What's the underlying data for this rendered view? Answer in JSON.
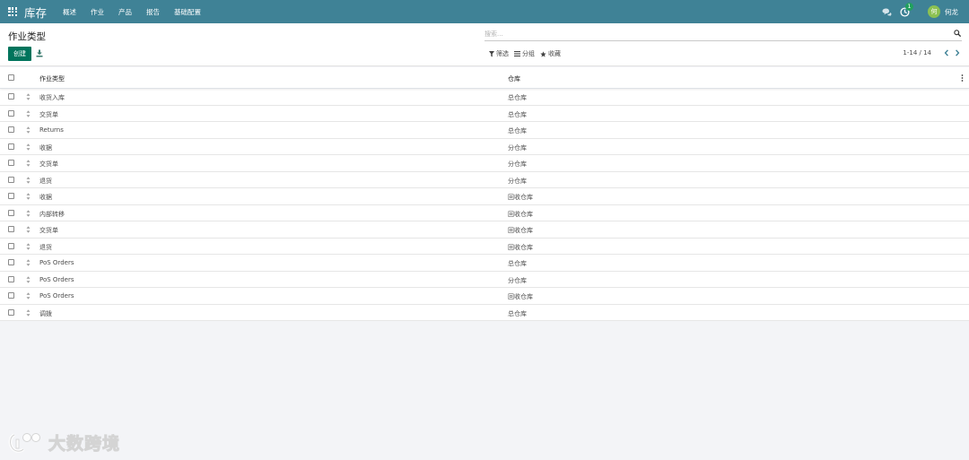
{
  "navbar": {
    "brand": "库存",
    "menu": [
      "概述",
      "作业",
      "产品",
      "报告",
      "基础配置"
    ],
    "activity_count": "1",
    "user_initial": "何",
    "user_name": "何龙",
    "bg_color": "#3f8296"
  },
  "control_panel": {
    "title": "作业类型",
    "search_placeholder": "搜索...",
    "create_label": "创建",
    "filters": {
      "filter": "筛选",
      "group_by": "分组",
      "favorites": "收藏"
    },
    "pager": "1-14 / 14"
  },
  "table": {
    "columns": {
      "name": "作业类型",
      "warehouse": "仓库"
    },
    "rows": [
      {
        "name": "收货入库",
        "warehouse": "总仓库"
      },
      {
        "name": "交货单",
        "warehouse": "总仓库"
      },
      {
        "name": "Returns",
        "warehouse": "总仓库"
      },
      {
        "name": "收据",
        "warehouse": "分仓库"
      },
      {
        "name": "交货单",
        "warehouse": "分仓库"
      },
      {
        "name": "退货",
        "warehouse": "分仓库"
      },
      {
        "name": "收据",
        "warehouse": "回收仓库"
      },
      {
        "name": "内部转移",
        "warehouse": "回收仓库"
      },
      {
        "name": "交货单",
        "warehouse": "回收仓库"
      },
      {
        "name": "退货",
        "warehouse": "回收仓库"
      },
      {
        "name": "PoS Orders",
        "warehouse": "总仓库"
      },
      {
        "name": "PoS Orders",
        "warehouse": "分仓库"
      },
      {
        "name": "PoS Orders",
        "warehouse": "回收仓库"
      },
      {
        "name": "调拨",
        "warehouse": "总仓库"
      }
    ]
  },
  "watermark": {
    "text": "大数跨境"
  },
  "colors": {
    "primary": "#00745c",
    "badge": "#21a05d",
    "avatar": "#8cc152"
  }
}
